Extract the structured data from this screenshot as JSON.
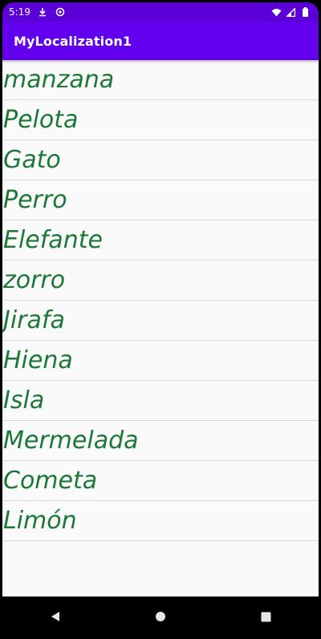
{
  "status_bar": {
    "time": "5:19",
    "icons": [
      "download-icon",
      "data-saver-icon",
      "wifi-icon",
      "signal-icon",
      "battery-icon"
    ]
  },
  "app_bar": {
    "title": "MyLocalization1",
    "color": "#6200ee"
  },
  "list": {
    "items": [
      {
        "label": "manzana"
      },
      {
        "label": "Pelota"
      },
      {
        "label": "Gato"
      },
      {
        "label": "Perro"
      },
      {
        "label": "Elefante"
      },
      {
        "label": "zorro"
      },
      {
        "label": "Jirafa"
      },
      {
        "label": "Hiena"
      },
      {
        "label": "Isla"
      },
      {
        "label": "Mermelada"
      },
      {
        "label": "Cometa"
      },
      {
        "label": "Limón"
      }
    ],
    "text_color": "#1b7837"
  },
  "nav_bar": {
    "buttons": [
      "back-icon",
      "home-icon",
      "recents-icon"
    ]
  }
}
